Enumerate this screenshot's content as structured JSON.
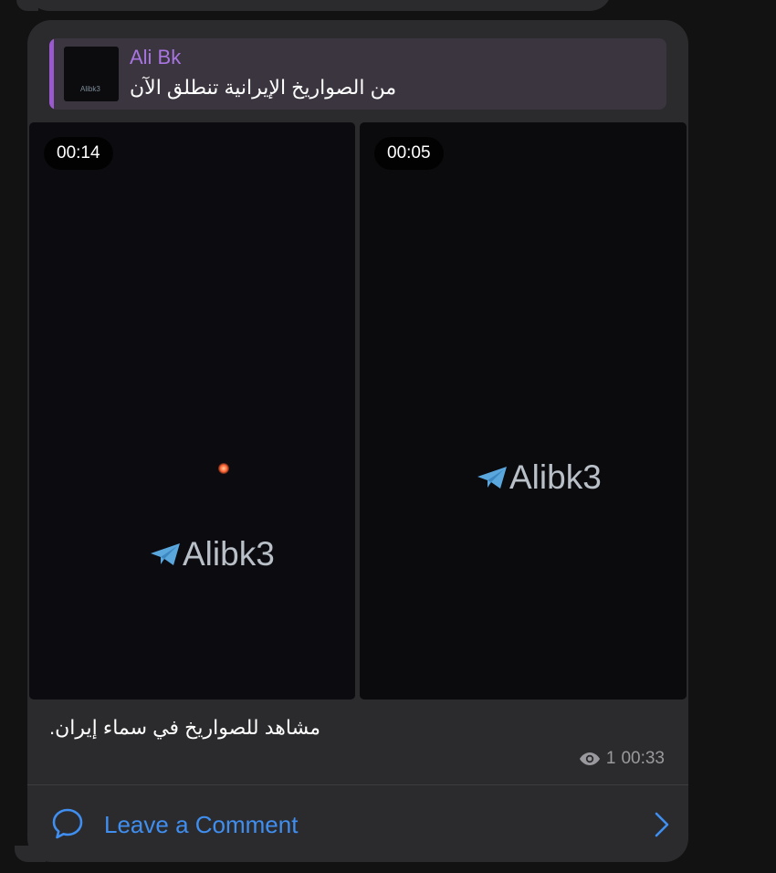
{
  "message": {
    "reply": {
      "author": "Ali Bk",
      "text": "من الصواريخ الإيرانية تنطلق الآن",
      "thumb_watermark": "Alibk3"
    },
    "videos": [
      {
        "duration": "00:14",
        "watermark": "Alibk3"
      },
      {
        "duration": "00:05",
        "watermark": "Alibk3"
      }
    ],
    "caption": "مشاهد للصواريخ في سماء إيران.",
    "views": "1",
    "time": "00:33",
    "comment_label": "Leave a Comment"
  },
  "colors": {
    "accent": "#3f8ef0",
    "reply_author": "#a875e0",
    "bubble": "#2b2b2d"
  },
  "icons": [
    "eye-icon",
    "comment-bubble-icon",
    "chevron-right-icon",
    "paper-plane-icon"
  ]
}
